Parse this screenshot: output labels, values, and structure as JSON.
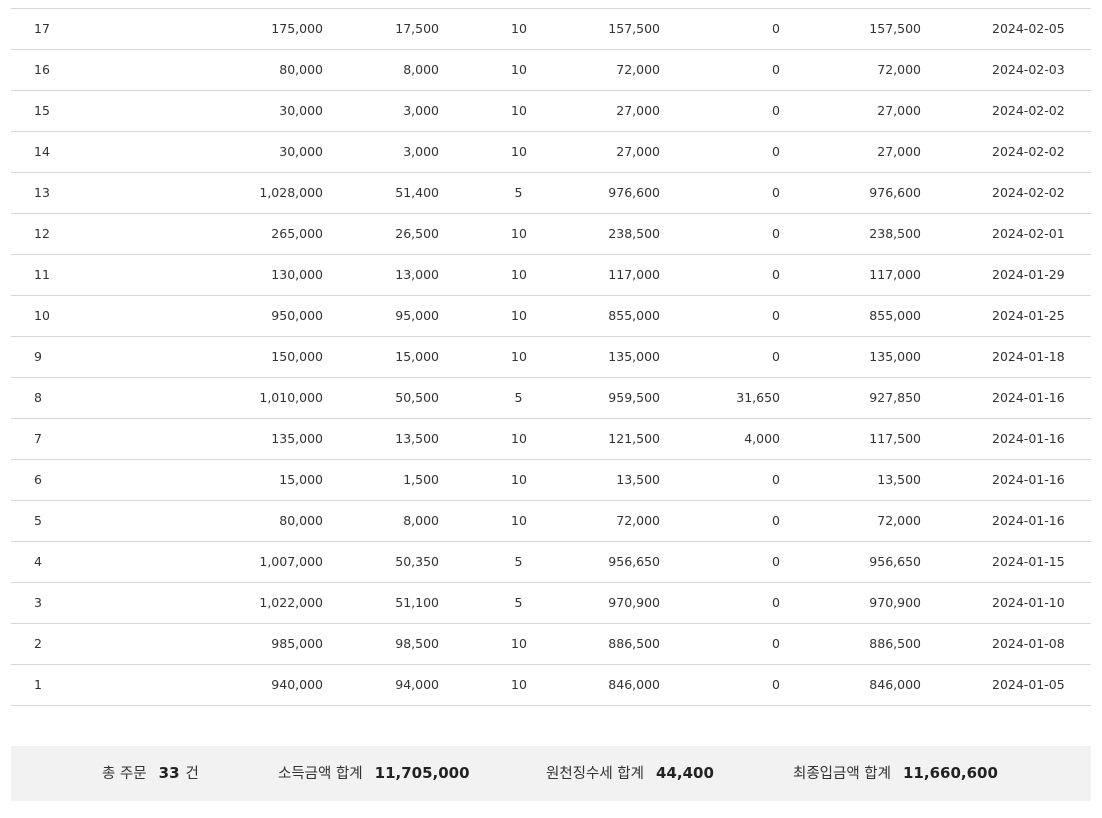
{
  "rows": [
    {
      "no": "17",
      "amount": "175,000",
      "fee": "17,500",
      "rate": "10",
      "net": "157,500",
      "tax": "0",
      "final": "157,500",
      "date": "2024-02-05"
    },
    {
      "no": "16",
      "amount": "80,000",
      "fee": "8,000",
      "rate": "10",
      "net": "72,000",
      "tax": "0",
      "final": "72,000",
      "date": "2024-02-03"
    },
    {
      "no": "15",
      "amount": "30,000",
      "fee": "3,000",
      "rate": "10",
      "net": "27,000",
      "tax": "0",
      "final": "27,000",
      "date": "2024-02-02"
    },
    {
      "no": "14",
      "amount": "30,000",
      "fee": "3,000",
      "rate": "10",
      "net": "27,000",
      "tax": "0",
      "final": "27,000",
      "date": "2024-02-02"
    },
    {
      "no": "13",
      "amount": "1,028,000",
      "fee": "51,400",
      "rate": "5",
      "net": "976,600",
      "tax": "0",
      "final": "976,600",
      "date": "2024-02-02"
    },
    {
      "no": "12",
      "amount": "265,000",
      "fee": "26,500",
      "rate": "10",
      "net": "238,500",
      "tax": "0",
      "final": "238,500",
      "date": "2024-02-01"
    },
    {
      "no": "11",
      "amount": "130,000",
      "fee": "13,000",
      "rate": "10",
      "net": "117,000",
      "tax": "0",
      "final": "117,000",
      "date": "2024-01-29"
    },
    {
      "no": "10",
      "amount": "950,000",
      "fee": "95,000",
      "rate": "10",
      "net": "855,000",
      "tax": "0",
      "final": "855,000",
      "date": "2024-01-25"
    },
    {
      "no": "9",
      "amount": "150,000",
      "fee": "15,000",
      "rate": "10",
      "net": "135,000",
      "tax": "0",
      "final": "135,000",
      "date": "2024-01-18"
    },
    {
      "no": "8",
      "amount": "1,010,000",
      "fee": "50,500",
      "rate": "5",
      "net": "959,500",
      "tax": "31,650",
      "final": "927,850",
      "date": "2024-01-16"
    },
    {
      "no": "7",
      "amount": "135,000",
      "fee": "13,500",
      "rate": "10",
      "net": "121,500",
      "tax": "4,000",
      "final": "117,500",
      "date": "2024-01-16"
    },
    {
      "no": "6",
      "amount": "15,000",
      "fee": "1,500",
      "rate": "10",
      "net": "13,500",
      "tax": "0",
      "final": "13,500",
      "date": "2024-01-16"
    },
    {
      "no": "5",
      "amount": "80,000",
      "fee": "8,000",
      "rate": "10",
      "net": "72,000",
      "tax": "0",
      "final": "72,000",
      "date": "2024-01-16"
    },
    {
      "no": "4",
      "amount": "1,007,000",
      "fee": "50,350",
      "rate": "5",
      "net": "956,650",
      "tax": "0",
      "final": "956,650",
      "date": "2024-01-15"
    },
    {
      "no": "3",
      "amount": "1,022,000",
      "fee": "51,100",
      "rate": "5",
      "net": "970,900",
      "tax": "0",
      "final": "970,900",
      "date": "2024-01-10"
    },
    {
      "no": "2",
      "amount": "985,000",
      "fee": "98,500",
      "rate": "10",
      "net": "886,500",
      "tax": "0",
      "final": "886,500",
      "date": "2024-01-08"
    },
    {
      "no": "1",
      "amount": "940,000",
      "fee": "94,000",
      "rate": "10",
      "net": "846,000",
      "tax": "0",
      "final": "846,000",
      "date": "2024-01-05"
    }
  ],
  "summary": {
    "total_orders_label": "총 주문",
    "total_orders_value": "33",
    "total_orders_unit": "건",
    "income_label": "소득금액 합계",
    "income_value": "11,705,000",
    "withholding_label": "원천징수세 합계",
    "withholding_value": "44,400",
    "final_deposit_label": "최종입금액 합계",
    "final_deposit_value": "11,660,600"
  }
}
